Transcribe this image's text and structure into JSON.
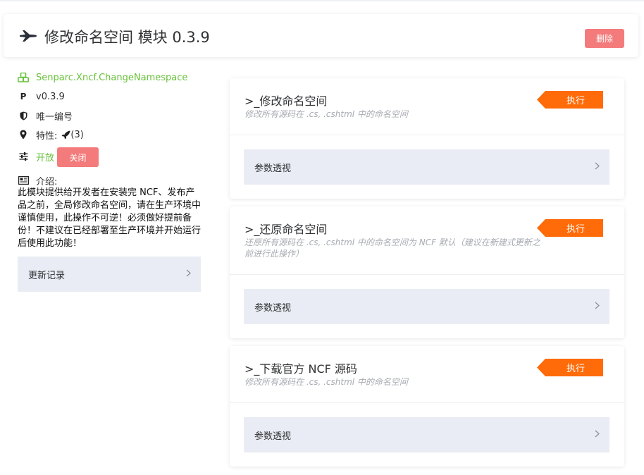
{
  "header": {
    "title": "修改命名空间 模块 0.3.9",
    "delete_label": "删除"
  },
  "info": {
    "package": "Senparc.Xncf.ChangeNamespace",
    "version": "v0.3.9",
    "uid_label": "唯一编号",
    "features_label": "特性:",
    "features_count": "(3)",
    "status_open": "开放",
    "close_label": "关闭",
    "intro_label": "介绍:",
    "intro_text": "此模块提供给开发者在安装完 NCF、发布产品之前，全局修改命名空间，请在生产环境中谨慎使用，此操作不可逆！必须做好提前备份！不建议在已经部署至生产环境并开始运行后使用此功能！",
    "changelog_label": "更新记录"
  },
  "functions": [
    {
      "title": ">_修改命名空间",
      "desc": "修改所有源码在 .cs, .cshtml 中的命名空间",
      "exec_label": "执行",
      "param_label": "参数透视"
    },
    {
      "title": ">_还原命名空间",
      "desc": "还原所有源码在 .cs, .cshtml 中的命名空间为 NCF 默认（建议在新建式更新之前进行此操作）",
      "exec_label": "执行",
      "param_label": "参数透视"
    },
    {
      "title": ">_下载官方 NCF 源码",
      "desc": "修改所有源码在 .cs, .cshtml 中的命名空间",
      "exec_label": "执行",
      "param_label": "参数透视"
    }
  ],
  "colors": {
    "accent_green": "#67c23a",
    "danger": "#f47b7b",
    "exec_orange": "#ff6b08",
    "panel_bg": "#e9ecf4"
  },
  "icons": [
    "fighter-jet-icon",
    "cubes-icon",
    "product-hunt-icon",
    "shield-icon",
    "map-pin-icon",
    "rocket-icon",
    "sliders-icon",
    "newspaper-icon",
    "chevron-right-icon"
  ]
}
